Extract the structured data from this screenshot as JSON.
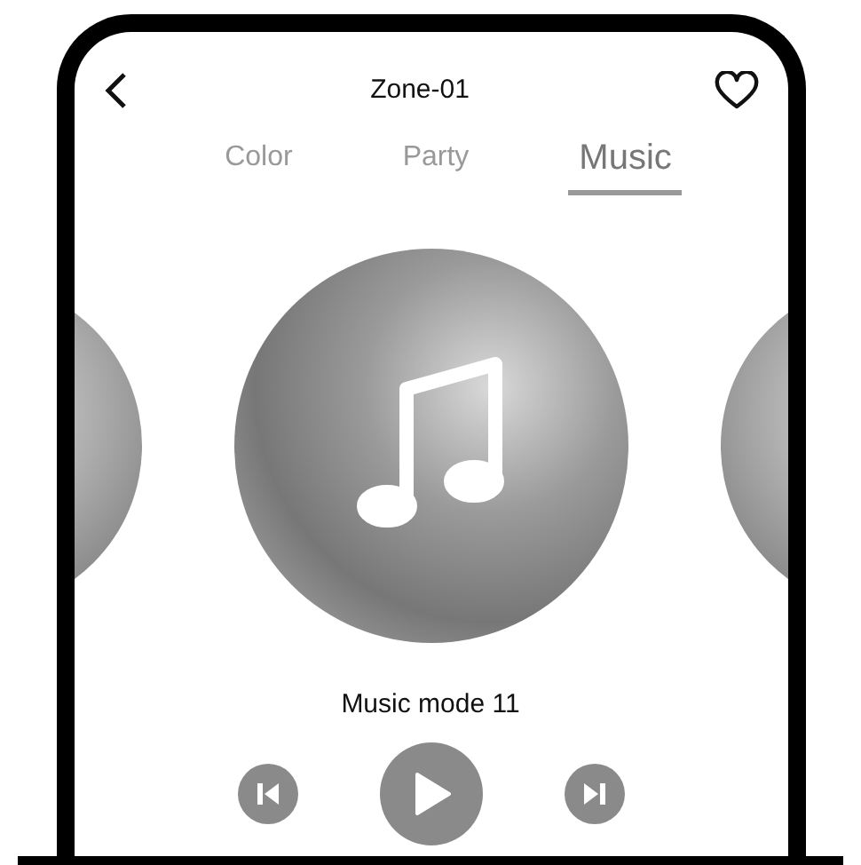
{
  "header": {
    "title": "Zone-01",
    "favorite": false
  },
  "tabs": [
    {
      "label": "Color",
      "selected": false
    },
    {
      "label": "Party",
      "selected": false
    },
    {
      "label": "Music",
      "selected": true
    }
  ],
  "carousel": [
    {
      "kind": "side"
    },
    {
      "kind": "main"
    },
    {
      "kind": "side"
    }
  ],
  "mode_label": "Music mode 11",
  "controls": [
    {
      "kind": "previous"
    },
    {
      "kind": "play"
    },
    {
      "kind": "next"
    }
  ]
}
